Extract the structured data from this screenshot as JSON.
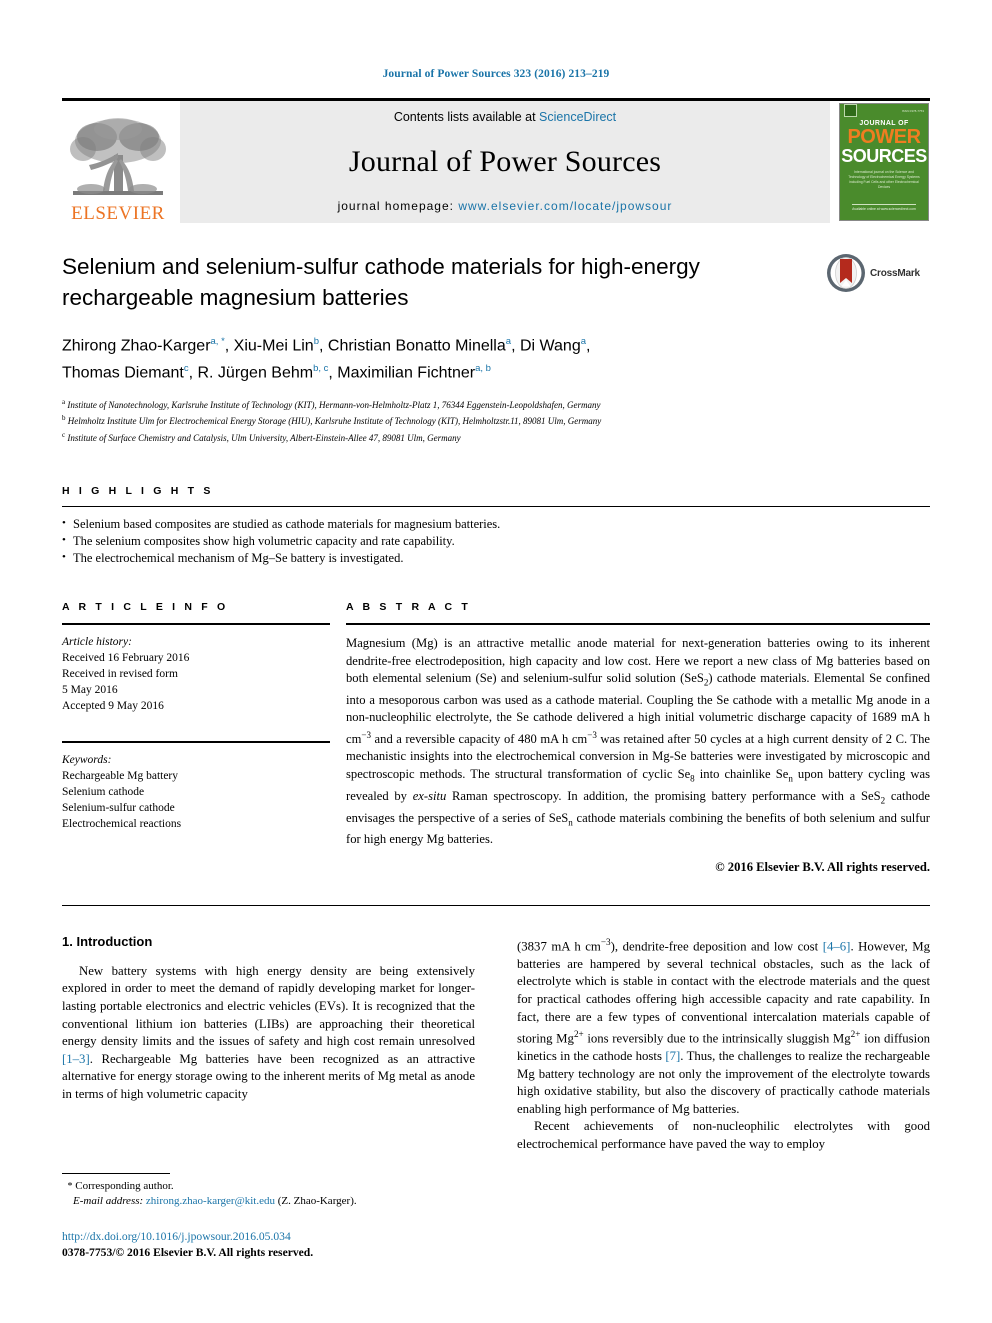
{
  "running_head": "Journal of Power Sources 323 (2016) 213–219",
  "masthead": {
    "elsevier_label": "ELSEVIER",
    "contents_prefix": "Contents lists available at ",
    "contents_link": "ScienceDirect",
    "journal_title": "Journal of Power Sources",
    "homepage_prefix": "journal homepage: ",
    "homepage_url": "www.elsevier.com/locate/jpowsour",
    "cover": {
      "line1": "JOURNAL OF",
      "line2": "POWER",
      "line3": "SOURCES",
      "blurb": "International journal on the Science and Technology of Electrochemical Energy Systems including Fuel Cells and other Electrochemical Devices",
      "bottom": "Available online at www.sciencedirect.com"
    }
  },
  "article": {
    "title": "Selenium and selenium-sulfur cathode materials for high-energy rechargeable magnesium batteries",
    "crossmark_label": "CrossMark",
    "authors_line1": "Zhirong Zhao-Karger",
    "authors_line1_sup": "a, *",
    "authors_line1b": ", Xiu-Mei Lin",
    "authors_line1b_sup": "b",
    "authors_line1c": ", Christian Bonatto Minella",
    "authors_line1c_sup": "a",
    "authors_line1d": ", Di Wang",
    "authors_line1d_sup": "a",
    "authors_line2": "Thomas Diemant",
    "authors_line2_sup": "c",
    "authors_line2b": ", R. Jürgen Behm",
    "authors_line2b_sup": "b, c",
    "authors_line2c": ", Maximilian Fichtner",
    "authors_line2c_sup": "a, b",
    "affiliations": [
      {
        "marker": "a",
        "text": "Institute of Nanotechnology, Karlsruhe Institute of Technology (KIT), Hermann-von-Helmholtz-Platz 1, 76344 Eggenstein-Leopoldshafen, Germany"
      },
      {
        "marker": "b",
        "text": "Helmholtz Institute Ulm for Electrochemical Energy Storage (HIU), Karlsruhe Institute of Technology (KIT), Helmholtzstr.11, 89081 Ulm, Germany"
      },
      {
        "marker": "c",
        "text": "Institute of Surface Chemistry and Catalysis, Ulm University, Albert-Einstein-Allee 47, 89081 Ulm, Germany"
      }
    ]
  },
  "highlights": {
    "label": "H I G H L I G H T S",
    "items": [
      "Selenium based composites are studied as cathode materials for magnesium batteries.",
      "The selenium composites show high volumetric capacity and rate capability.",
      "The electrochemical mechanism of Mg–Se battery is investigated."
    ]
  },
  "article_info": {
    "label": "A R T I C L E  I N F O",
    "history_label": "Article history:",
    "history": [
      "Received 16 February 2016",
      "Received in revised form",
      "5 May 2016",
      "Accepted 9 May 2016"
    ],
    "keywords_label": "Keywords:",
    "keywords": [
      "Rechargeable Mg battery",
      "Selenium cathode",
      "Selenium-sulfur cathode",
      "Electrochemical reactions"
    ]
  },
  "abstract": {
    "label": "A B S T R A C T",
    "part1": "Magnesium (Mg) is an attractive metallic anode material for next-generation batteries owing to its inherent dendrite-free electrodeposition, high capacity and low cost. Here we report a new class of Mg batteries based on both elemental selenium (Se) and selenium-sulfur solid solution (SeS",
    "sub1": "2",
    "part2": ") cathode materials. Elemental Se confined into a mesoporous carbon was used as a cathode material. Coupling the Se cathode with a metallic Mg anode in a non-nucleophilic electrolyte, the Se cathode delivered a high initial volumetric discharge capacity of 1689 mA h cm",
    "sup1": "−3",
    "part3": " and a reversible capacity of 480 mA h cm",
    "sup2": "−3",
    "part4": " was retained after 50 cycles at a high current density of 2 C. The mechanistic insights into the electrochemical conversion in Mg-Se batteries were investigated by microscopic and spectroscopic methods. The structural transformation of cyclic Se",
    "sub2": "8",
    "part5": " into chainlike Se",
    "sub3": "n",
    "part6": " upon battery cycling was revealed by ",
    "italic1": "ex-situ",
    "part7": " Raman spectroscopy. In addition, the promising battery performance with a SeS",
    "sub4": "2",
    "part8": " cathode envisages the perspective of a series of SeS",
    "sub5": "n",
    "part9": " cathode materials combining the benefits of both selenium and sulfur for high energy Mg batteries.",
    "copyright": "© 2016 Elsevier B.V. All rights reserved."
  },
  "intro": {
    "heading": "1. Introduction",
    "left_p1_a": "New battery systems with high energy density are being extensively explored in order to meet the demand of rapidly developing market for longer-lasting portable electronics and electric vehicles (EVs). It is recognized that the conventional lithium ion batteries (LIBs) are approaching their theoretical energy density limits and the issues of safety and high cost remain unresolved ",
    "left_ref1": "[1–3]",
    "left_p1_b": ". Rechargeable Mg batteries have been recognized as an attractive alternative for energy storage owing to the inherent merits of Mg metal as anode in terms of high volumetric capacity",
    "right_p1_a": "(3837 mA h cm",
    "right_sup1": "−3",
    "right_p1_b": "), dendrite-free deposition and low cost ",
    "right_ref1": "[4–6]",
    "right_p1_c": ". However, Mg batteries are hampered by several technical obstacles, such as the lack of electrolyte which is stable in contact with the electrode materials and the quest for practical cathodes offering high accessible capacity and rate capability. In fact, there are a few types of conventional intercalation materials capable of storing Mg",
    "right_sup2": "2+",
    "right_p1_d": " ions reversibly due to the intrinsically sluggish Mg",
    "right_sup3": "2+",
    "right_p1_e": " ion diffusion kinetics in the cathode hosts ",
    "right_ref2": "[7]",
    "right_p1_f": ". Thus, the challenges to realize the rechargeable Mg battery technology are not only the improvement of the electrolyte towards high oxidative stability, but also the discovery of practically cathode materials enabling high performance of Mg batteries.",
    "right_p2": "Recent achievements of non-nucleophilic electrolytes with good electrochemical performance have paved the way to employ"
  },
  "footer": {
    "corresponding_star": "*",
    "corresponding_label": "Corresponding author.",
    "email_label": "E-mail address:",
    "email": "zhirong.zhao-karger@kit.edu",
    "email_suffix": "(Z. Zhao-Karger).",
    "doi": "http://dx.doi.org/10.1016/j.jpowsour.2016.05.034",
    "issn_line": "0378-7753/© 2016 Elsevier B.V. All rights reserved."
  },
  "colors": {
    "link": "#1a74a8",
    "elsevier_orange": "#ec7424",
    "cover_green": "#4a8b2c",
    "crossmark_red": "#b42a1d"
  }
}
